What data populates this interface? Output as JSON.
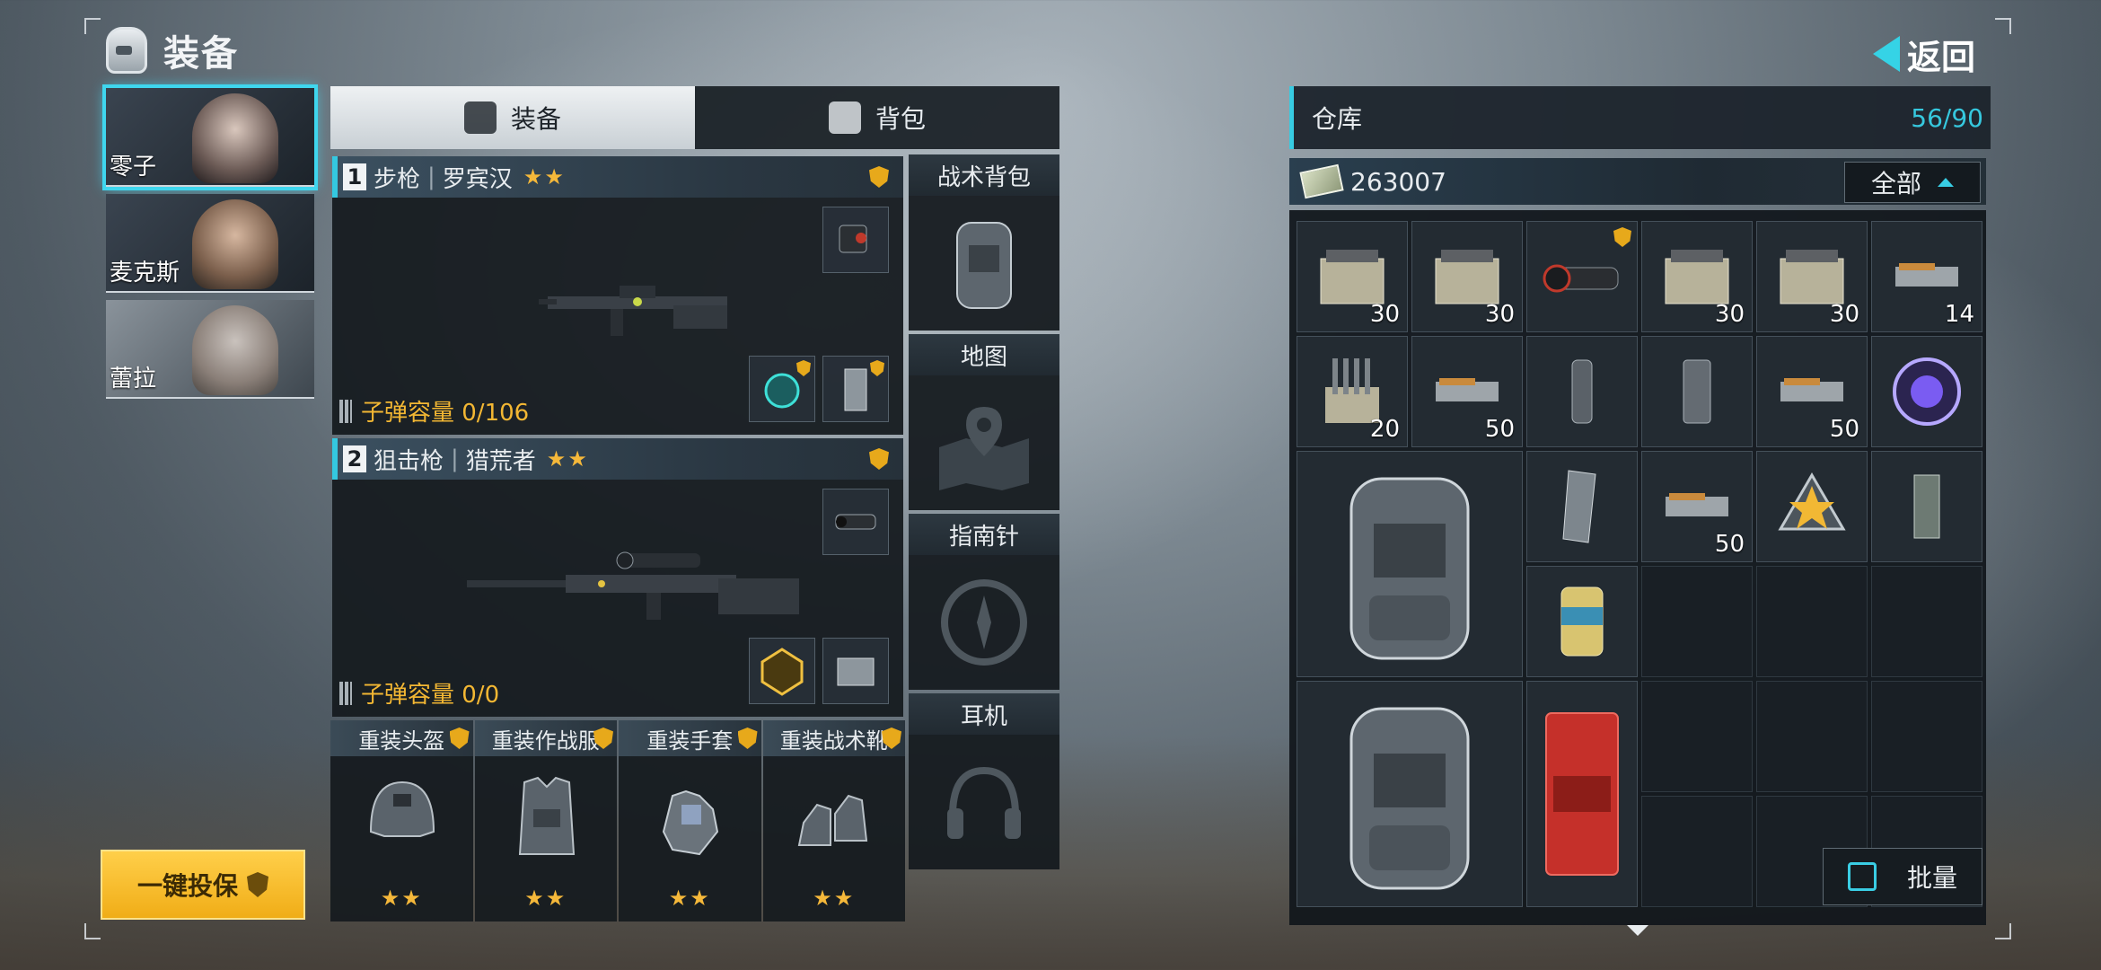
{
  "header": {
    "title": "装备",
    "back_label": "返回"
  },
  "characters": [
    {
      "name": "零子",
      "selected": true
    },
    {
      "name": "麦克斯",
      "selected": false
    },
    {
      "name": "蕾拉",
      "selected": false
    }
  ],
  "insure_button": "一键投保",
  "tabs": [
    {
      "label": "装备",
      "active": true
    },
    {
      "label": "背包",
      "active": false
    }
  ],
  "weapons": [
    {
      "slot": "1",
      "type": "步枪",
      "name": "罗宾汉",
      "stars": "★★",
      "ammo": "子弹容量 0/106"
    },
    {
      "slot": "2",
      "type": "狙击枪",
      "name": "猎荒者",
      "stars": "★★",
      "ammo": "子弹容量 0/0"
    }
  ],
  "armor": [
    {
      "label": "重装头盔",
      "stars": "★★",
      "icon": "helmet-icon"
    },
    {
      "label": "重装作战服",
      "stars": "★★",
      "icon": "vest-icon"
    },
    {
      "label": "重装手套",
      "stars": "★★",
      "icon": "gloves-icon"
    },
    {
      "label": "重装战术靴",
      "stars": "★★",
      "icon": "boots-icon"
    }
  ],
  "side_slots": [
    {
      "label": "战术背包",
      "icon": "backpack-icon"
    },
    {
      "label": "地图",
      "icon": "map-pin-icon"
    },
    {
      "label": "指南针",
      "icon": "compass-icon"
    },
    {
      "label": "耳机",
      "icon": "headphones-icon"
    }
  ],
  "warehouse": {
    "label": "仓库",
    "capacity": "56/90",
    "money": "263007",
    "filter": "全部",
    "batch_label": "批量"
  },
  "inventory_counts": {
    "r1c1": "30",
    "r1c2": "30",
    "r1c4": "30",
    "r1c5": "30",
    "r1c6": "14",
    "r2c1": "20",
    "r2c2": "50",
    "r2c5": "50",
    "r3c4": "50"
  },
  "colors": {
    "accent": "#36c8de",
    "gold": "#f3b733",
    "star": "#f5b83a"
  }
}
